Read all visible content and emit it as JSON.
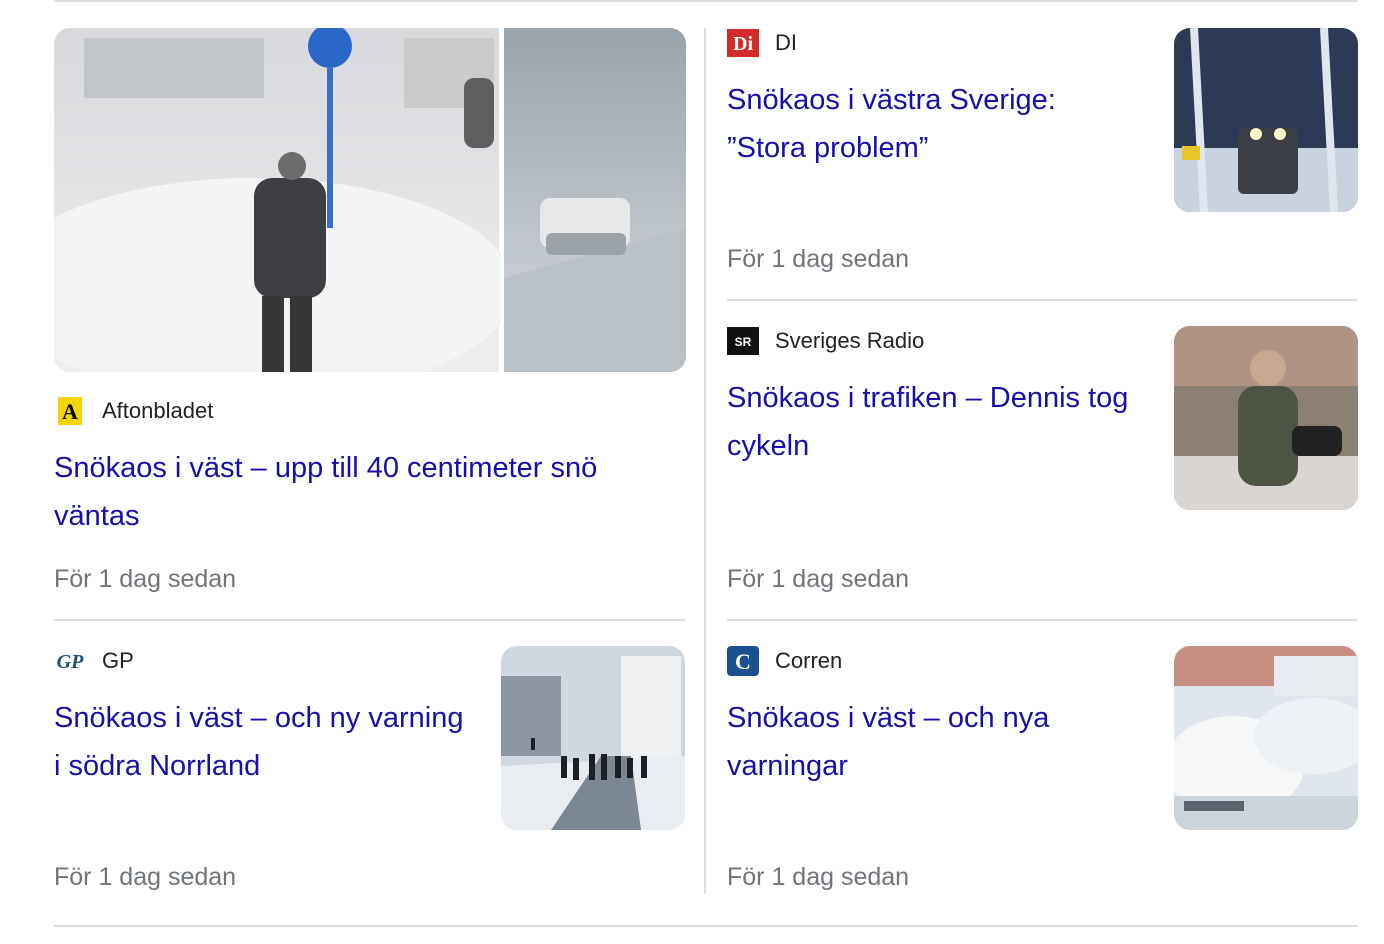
{
  "items": [
    {
      "source": "Aftonbladet",
      "logo": "aftonbladet-logo",
      "title": "Snökaos i väst – upp till 40 centimeter snö väntas",
      "time": "För 1 dag sedan",
      "image": "snowstorm-pedestrian-image"
    },
    {
      "source": "DI",
      "logo": "di-logo",
      "title": "Snökaos i västra Sverige: ”Stora problem”",
      "time": "För 1 dag sedan",
      "image": "snow-train-plow-image"
    },
    {
      "source": "Sveriges Radio",
      "logo": "sveriges-radio-logo",
      "title": "Snökaos i trafiken – Dennis tog cykeln",
      "time": "För 1 dag sedan",
      "image": "man-with-bike-image"
    },
    {
      "source": "GP",
      "logo": "gp-logo",
      "title": "Snökaos i väst – och ny varning i södra Norrland",
      "time": "För 1 dag sedan",
      "image": "people-walking-snow-image"
    },
    {
      "source": "Corren",
      "logo": "corren-logo",
      "title": "Snökaos i väst – och nya varningar",
      "time": "För 1 dag sedan",
      "image": "snow-covered-cars-image"
    }
  ],
  "colors": {
    "link": "#1a0dab",
    "meta": "#70757a",
    "divider": "#dadce0"
  }
}
